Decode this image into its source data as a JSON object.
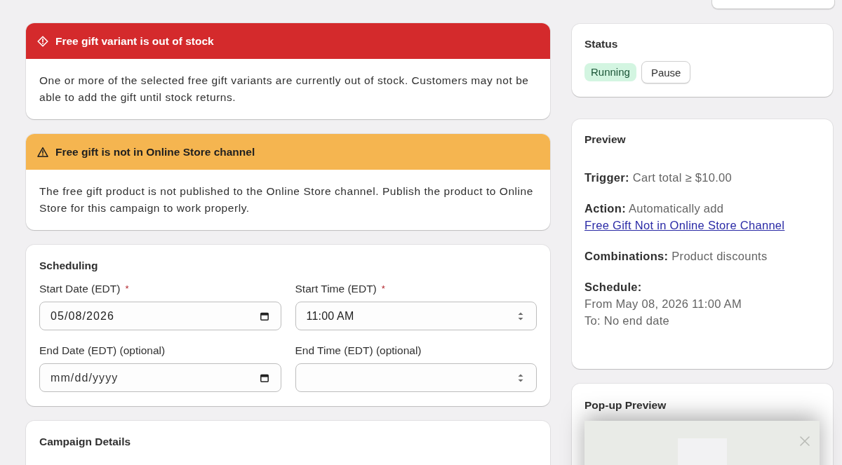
{
  "alerts": [
    {
      "kind": "error",
      "title": "Free gift variant is out of stock",
      "body": "One or more of the selected free gift variants are currently out of stock. Customers may not be able to add the gift until stock returns."
    },
    {
      "kind": "warning",
      "title": "Free gift is not in Online Store channel",
      "body": "The free gift product is not published to the Online Store channel. Publish the product to Online Store for this campaign to work properly."
    }
  ],
  "scheduling": {
    "title": "Scheduling",
    "fields": [
      {
        "kind": "date",
        "label": "Start Date (EDT)",
        "required_mark": "*",
        "value": "05/08/2026"
      },
      {
        "kind": "time",
        "label": "Start Time (EDT)",
        "required_mark": "*",
        "value": "11:00 AM"
      },
      {
        "kind": "date",
        "label": "End Date (EDT) (optional)",
        "placeholder": "mm/dd/yyyy"
      },
      {
        "kind": "time",
        "label": "End Time (EDT) (optional)"
      }
    ]
  },
  "campaign_details": {
    "title": "Campaign Details"
  },
  "status": {
    "title": "Status",
    "badge": "Running",
    "button": "Pause"
  },
  "preview": {
    "title": "Preview",
    "items": [
      {
        "kind": "text",
        "text": "**Trigger:** Cart total ≥ $10.00"
      },
      {
        "kind": "link",
        "text": "**Action:** Automatically add",
        "link": "Free Gift Not in Online Store Channel"
      },
      {
        "kind": "text",
        "text": "**Combinations:** Product discounts"
      },
      {
        "kind": "lines",
        "label": "Schedule:",
        "lines": [
          "From May 08, 2026 11:00 AM",
          "To: No end date"
        ]
      }
    ]
  },
  "popup_preview": {
    "title": "Pop-up Preview"
  }
}
